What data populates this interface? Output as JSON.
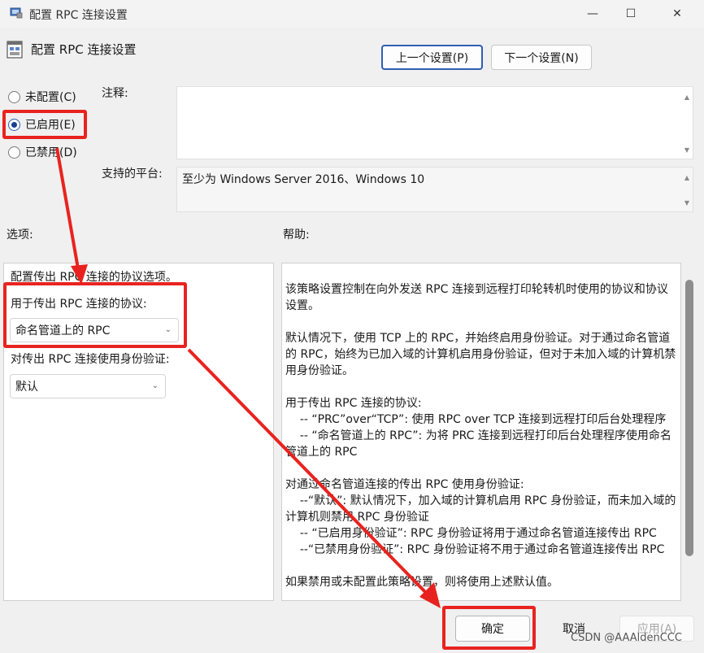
{
  "titlebar": {
    "title": "配置 RPC 连接设置",
    "minimize": "—",
    "maximize": "☐",
    "close": "✕"
  },
  "header": {
    "title": "配置 RPC 连接设置",
    "prev_button": "上一个设置(P)",
    "next_button": "下一个设置(N)"
  },
  "radio": {
    "not_configured": "未配置(C)",
    "enabled": "已启用(E)",
    "disabled": "已禁用(D)",
    "selected": "enabled"
  },
  "fields": {
    "notes_label": "注释:",
    "notes_value": "",
    "platform_label": "支持的平台:",
    "platform_value": "至少为 Windows Server 2016、Windows 10"
  },
  "sections": {
    "options_label": "选项:",
    "help_label": "帮助:"
  },
  "options": {
    "intro": "配置传出 RPC 连接的协议选项。",
    "protocol_label": "用于传出 RPC 连接的协议:",
    "protocol_value": "命名管道上的 RPC",
    "auth_label": "对传出 RPC 连接使用身份验证:",
    "auth_value": "默认"
  },
  "help": {
    "text": "该策略设置控制在向外发送 RPC 连接到远程打印轮转机时使用的协议和协议设置。\n\n默认情况下，使用 TCP 上的 RPC，并始终启用身份验证。对于通过命名管道的 RPC，始终为已加入域的计算机启用身份验证，但对于未加入域的计算机禁用身份验证。\n\n用于传出 RPC 连接的协议:\n    -- “PRC”over“TCP”: 使用 RPC over TCP 连接到远程打印后台处理程序\n    -- “命名管道上的 RPC”: 为将 PRC 连接到远程打印后台处理程序使用命名管道上的 RPC\n\n对通过命名管道连接的传出 RPC 使用身份验证:\n    --“默认”: 默认情况下，加入域的计算机启用 RPC 身份验证，而未加入域的计算机则禁用 RPC 身份验证\n    -- “已启用身份验证”: RPC 身份验证将用于通过命名管道连接传出 RPC\n    --“已禁用身份验证”: RPC 身份验证将不用于通过命名管道连接传出 RPC\n\n如果禁用或未配置此策略设置，则将使用上述默认值。"
  },
  "footer": {
    "ok": "确定",
    "cancel": "取消",
    "apply": "应用(A)",
    "watermark": "CSDN @AAAldenCCC"
  },
  "annotation_color": "#e8231f",
  "accent_color": "#2f5fb4"
}
